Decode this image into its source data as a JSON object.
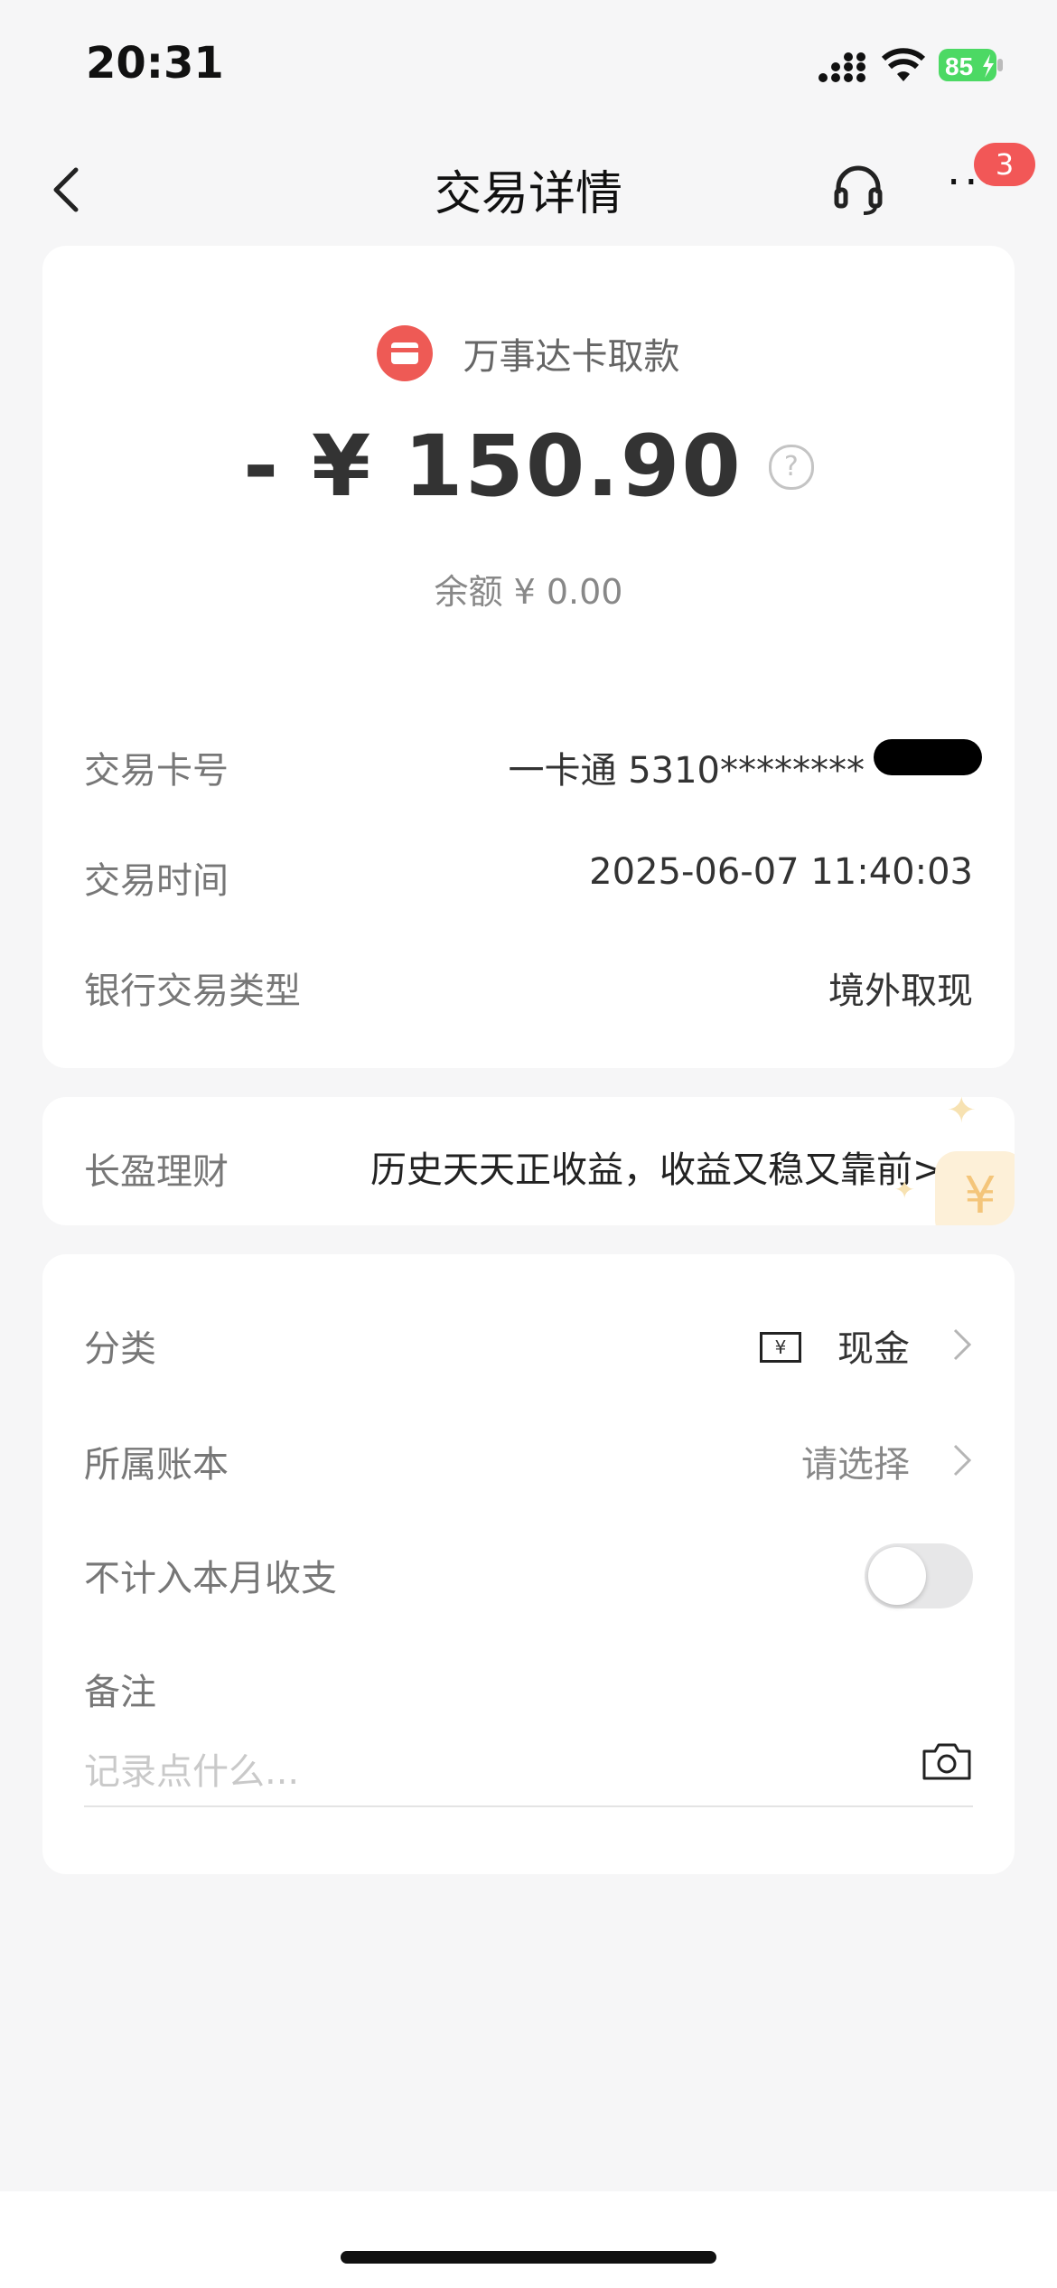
{
  "status_bar": {
    "time": "20:31",
    "battery": "85"
  },
  "nav": {
    "title": "交易详情",
    "more_label": "···",
    "badge_count": "3"
  },
  "summary": {
    "merchant": "万事达卡取款",
    "amount": "- ¥ 150.90",
    "help": "?",
    "balance": "余额 ¥ 0.00"
  },
  "details": [
    {
      "label": "交易卡号",
      "value": "一卡通 5310********"
    },
    {
      "label": "交易时间",
      "value": "2025-06-07 11:40:03"
    },
    {
      "label": "银行交易类型",
      "value": "境外取现"
    }
  ],
  "wealth": {
    "label": "长盈理财",
    "promo": "历史天天正收益，收益又稳又靠前>>",
    "deco": "¥"
  },
  "settings": {
    "category_label": "分类",
    "category_value": "现金",
    "category_icon": "¥",
    "ledger_label": "所属账本",
    "ledger_value": "请选择",
    "exclude_label": "不计入本月收支",
    "exclude_enabled": false,
    "note_label": "备注",
    "note_placeholder": "记录点什么..."
  },
  "colors": {
    "accent": "#ee5a55",
    "badge": "#f25757",
    "battery": "#4cd964"
  }
}
